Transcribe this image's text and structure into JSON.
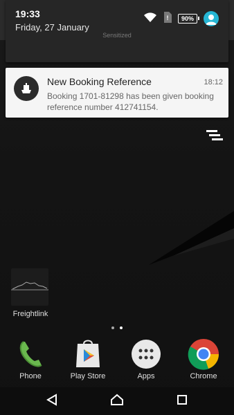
{
  "status_bar": {
    "time": "19:33",
    "date": "Friday, 27 January",
    "hidden_subtitle": "Sensitized",
    "battery": "90%"
  },
  "notification": {
    "title": "New Booking Reference",
    "time": "18:12",
    "body": "Booking 1701-81298 has been given booking reference number 412741154.",
    "icon": "ship-icon"
  },
  "home": {
    "widget_label": "Freightlink",
    "dock": [
      {
        "label": "Phone",
        "icon": "phone-icon"
      },
      {
        "label": "Play Store",
        "icon": "play-store-icon"
      },
      {
        "label": "Apps",
        "icon": "apps-grid-icon"
      },
      {
        "label": "Chrome",
        "icon": "chrome-icon"
      }
    ]
  },
  "colors": {
    "accent": "#26b6d4",
    "notification_bg": "#f5f5f5"
  }
}
